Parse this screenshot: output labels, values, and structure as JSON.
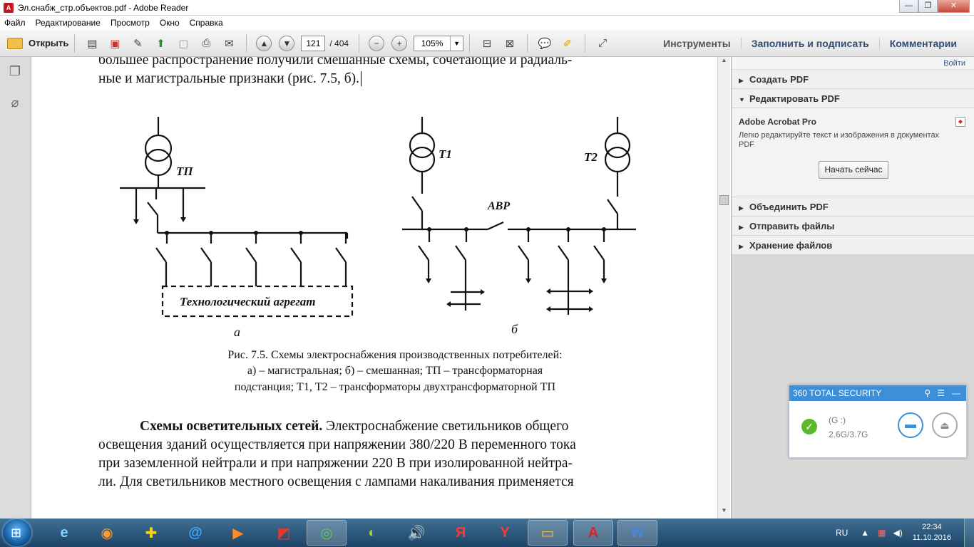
{
  "window": {
    "title": "Эл.снабж_стр.объектов.pdf - Adobe Reader",
    "controls": [
      "—",
      "❐",
      "✕"
    ]
  },
  "menu": [
    "Файл",
    "Редактирование",
    "Просмотр",
    "Окно",
    "Справка"
  ],
  "toolbar": {
    "open_label": "Открыть",
    "page_current": "121",
    "page_total": "/ 404",
    "zoom_value": "105%",
    "zoom_dropdown": "▼",
    "tools_label": "Инструменты",
    "fill_sign_label": "Заполнить и подписать",
    "comments_label": "Комментарии",
    "icons": [
      "create-pdf-icon",
      "convert-icon",
      "edit-icon",
      "upload-icon",
      "save-icon",
      "print-icon",
      "email-icon",
      "page-up-icon",
      "page-down-icon",
      "zoom-out-icon",
      "zoom-in-icon",
      "fit-page-icon",
      "fit-width-icon",
      "comment-icon",
      "highlight-icon",
      "expand-icon"
    ]
  },
  "document": {
    "top_line_1": "большее распространение получили смешанные схемы, сочетающие и радиаль-",
    "top_line_2": "ные и магистральные признаки (рис. 7.5, б).",
    "diagram": {
      "label_tp": "ТП",
      "label_t1": "Т1",
      "label_t2": "Т2",
      "label_avr": "АВР",
      "label_agg": "Технологический агрегат",
      "label_a": "а",
      "label_b": "б"
    },
    "caption_1": "Рис. 7.5. Схемы электроснабжения производственных потребителей:",
    "caption_2": "а) – магистральная; б) – смешанная; ТП – трансформаторная",
    "caption_3": "подстанция; Т1, Т2 – трансформаторы двухтрансформаторной ТП",
    "para_bold": "Схемы осветительных сетей.",
    "para_line_1": " Электроснабжение светильников общего",
    "para_line_2": "освещения зданий осуществляется при напряжении 380/220 В переменного тока",
    "para_line_3": "при заземленной нейтрали и при напряжении 220 В при изолированной нейтра-",
    "para_line_4": "ли. Для светильников местного освещения с лампами накаливания применяется"
  },
  "right_panel": {
    "login": "Войти",
    "sections": [
      {
        "label": "Создать PDF",
        "expanded": false
      },
      {
        "label": "Редактировать PDF",
        "expanded": true
      },
      {
        "label": "Объединить PDF",
        "expanded": false
      },
      {
        "label": "Отправить файлы",
        "expanded": false
      },
      {
        "label": "Хранение файлов",
        "expanded": false
      }
    ],
    "acrobat_title": "Adobe Acrobat Pro",
    "acrobat_desc": "Легко редактируйте текст и изображения в документах PDF",
    "start_button": "Начать сейчас"
  },
  "popup": {
    "title": "360 TOTAL SECURITY",
    "drive": "(G :)",
    "capacity": "2.6G/3.7G"
  },
  "taskbar": {
    "apps": [
      "ie-icon",
      "firefox-icon",
      "plus-icon",
      "at-icon",
      "media-icon",
      "acrobat-doc-icon",
      "360-icon",
      "image-icon",
      "volume-icon",
      "yandex-icon",
      "yandex-browser-icon",
      "explorer-icon",
      "adobe-reader-icon",
      "word-icon"
    ],
    "lang": "RU",
    "time": "22:34",
    "date": "11.10.2016"
  },
  "colors": {
    "accent": "#3d8fd8",
    "titlebar_close": "#c44b35",
    "taskbar": "#1d4466"
  }
}
